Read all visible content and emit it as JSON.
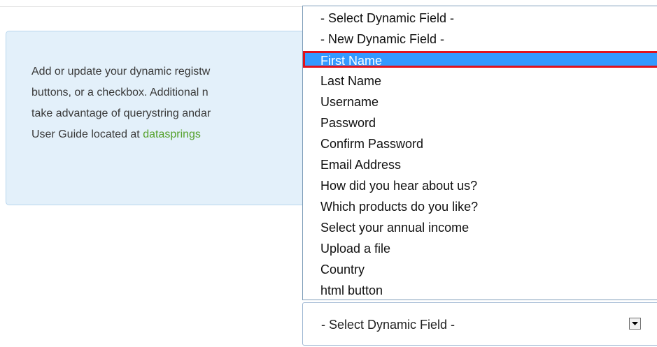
{
  "info": {
    "line1": "Add or update your dynamic registw",
    "line2": "buttons, or a checkbox. Additional  n",
    "line3": "take advantage of querystring andar",
    "line4_prefix": "User Guide located at ",
    "link_text": "datasprings"
  },
  "dropdown": {
    "options": [
      "- Select Dynamic Field -",
      "- New Dynamic Field -",
      "First Name",
      "Last Name",
      "Username",
      "Password",
      "Confirm Password",
      "Email Address",
      "How did you hear about us?",
      "Which products do you like?",
      "Select your annual income",
      "Upload a file",
      "Country",
      "html button"
    ],
    "selected_option": "First Name",
    "highlight_color": "#3399ff",
    "annotation_color": "#e0121c",
    "link_color": "#55a12c"
  },
  "select": {
    "value": "- Select Dynamic Field -",
    "arrow_icon": "chevron-down-icon"
  }
}
